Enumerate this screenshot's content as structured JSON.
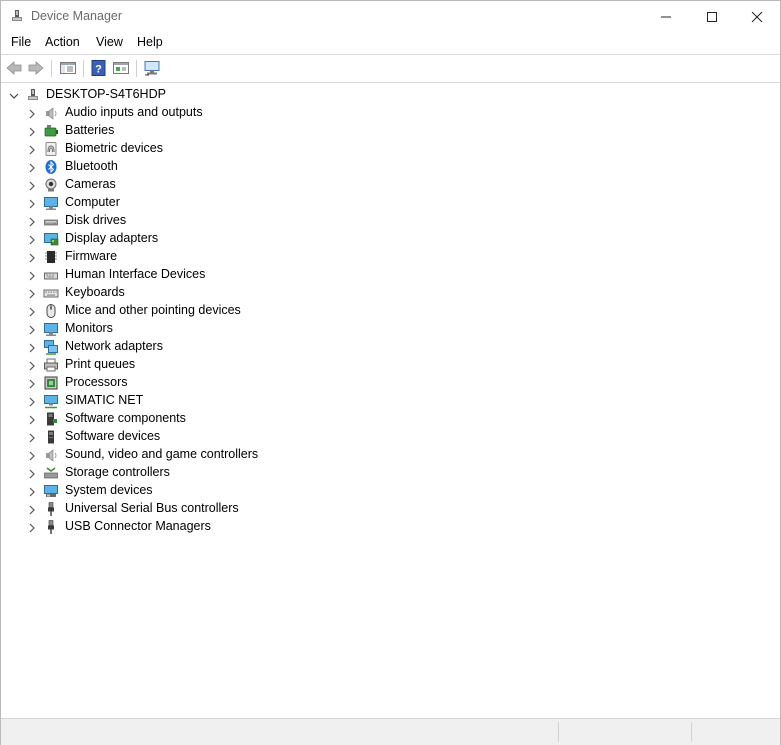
{
  "window": {
    "title": "Device Manager"
  },
  "menu": [
    "File",
    "Action",
    "View",
    "Help"
  ],
  "tree": {
    "root": "DESKTOP-S4T6HDP",
    "items": [
      {
        "label": "Audio inputs and outputs",
        "icon": "speaker-icon"
      },
      {
        "label": "Batteries",
        "icon": "battery-icon"
      },
      {
        "label": "Biometric devices",
        "icon": "fingerprint-icon"
      },
      {
        "label": "Bluetooth",
        "icon": "bluetooth-icon"
      },
      {
        "label": "Cameras",
        "icon": "camera-icon"
      },
      {
        "label": "Computer",
        "icon": "computer-icon"
      },
      {
        "label": "Disk drives",
        "icon": "disk-drive-icon"
      },
      {
        "label": "Display adapters",
        "icon": "display-adapter-icon"
      },
      {
        "label": "Firmware",
        "icon": "firmware-chip-icon"
      },
      {
        "label": "Human Interface Devices",
        "icon": "hid-icon"
      },
      {
        "label": "Keyboards",
        "icon": "keyboard-icon"
      },
      {
        "label": "Mice and other pointing devices",
        "icon": "mouse-icon"
      },
      {
        "label": "Monitors",
        "icon": "monitor-icon"
      },
      {
        "label": "Network adapters",
        "icon": "network-adapter-icon"
      },
      {
        "label": "Print queues",
        "icon": "printer-icon"
      },
      {
        "label": "Processors",
        "icon": "processor-icon"
      },
      {
        "label": "SIMATIC NET",
        "icon": "network-icon"
      },
      {
        "label": "Software components",
        "icon": "software-component-icon"
      },
      {
        "label": "Software devices",
        "icon": "software-device-icon"
      },
      {
        "label": "Sound, video and game controllers",
        "icon": "speaker-icon"
      },
      {
        "label": "Storage controllers",
        "icon": "storage-controller-icon"
      },
      {
        "label": "System devices",
        "icon": "system-devices-icon"
      },
      {
        "label": "Universal Serial Bus controllers",
        "icon": "usb-icon"
      },
      {
        "label": "USB Connector Managers",
        "icon": "usb-icon"
      }
    ]
  }
}
